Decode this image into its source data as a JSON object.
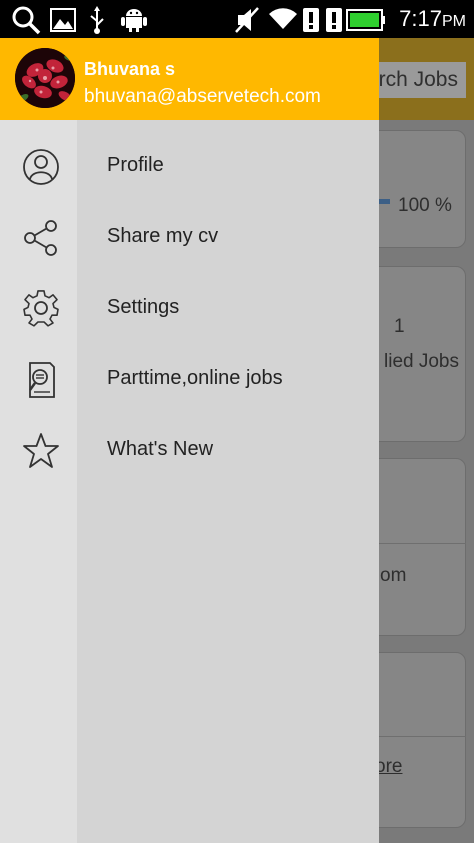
{
  "status_bar": {
    "time": "7:17",
    "ampm": "PM",
    "icons": [
      "search-icon",
      "image-icon",
      "usb-icon",
      "android-icon",
      "mute-icon",
      "wifi-icon",
      "alert-icon",
      "alert-icon",
      "battery-icon"
    ]
  },
  "background": {
    "search_label": "rch Jobs",
    "progress_text": "100 %",
    "applied_count": "1",
    "applied_label": "lied Jobs",
    "card3_text": "om",
    "card4_link": "ore"
  },
  "drawer": {
    "header": {
      "name": "Bhuvana s",
      "email": "bhuvana@abservetech.com",
      "color": "#ffb800"
    },
    "menu": [
      {
        "label": "Profile",
        "icon": "profile-icon"
      },
      {
        "label": "Share my cv",
        "icon": "share-icon"
      },
      {
        "label": "Settings",
        "icon": "gear-icon"
      },
      {
        "label": "Parttime,online jobs",
        "icon": "document-search-icon"
      },
      {
        "label": "What's New",
        "icon": "star-icon"
      }
    ]
  }
}
